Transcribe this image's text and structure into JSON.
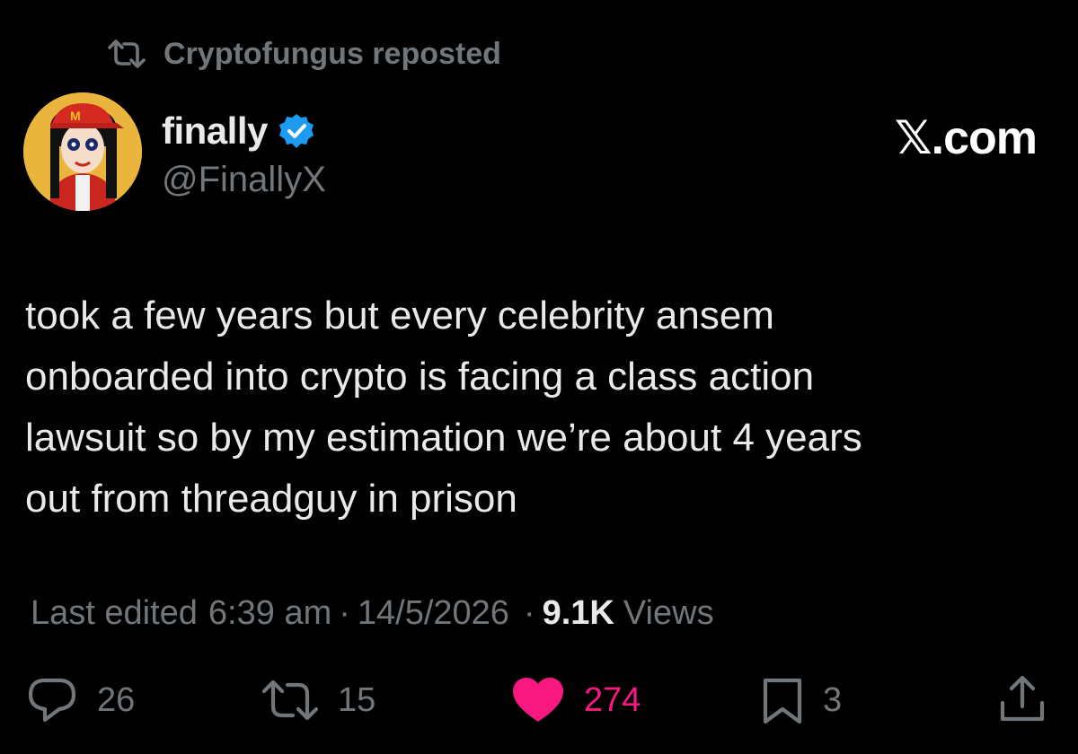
{
  "repost_banner": {
    "text": "Cryptofungus reposted",
    "icon": "repost-icon"
  },
  "author": {
    "display_name": "finally",
    "handle": "@FinallyX",
    "verified": true,
    "verified_color": "#1d9bf0"
  },
  "brand": "𝕏.com",
  "tweet": {
    "lines": [
      "took a few years but every celebrity ansem",
      "onboarded into crypto is facing a class action",
      "lawsuit so by my estimation we’re about 4 years",
      "out from threadguy in prison"
    ]
  },
  "meta": {
    "edited_label": "Last edited",
    "time": "6:39 am",
    "date": "14/5/2026",
    "views_count": "9.1K",
    "views_label": "Views",
    "separator": "·"
  },
  "actions": {
    "reply": {
      "icon": "reply-icon",
      "count": "26"
    },
    "repost": {
      "icon": "repost-icon",
      "count": "15"
    },
    "like": {
      "icon": "heart-icon",
      "count": "274",
      "liked": true,
      "color": "#f91880"
    },
    "bookmark": {
      "icon": "bookmark-icon",
      "count": "3"
    },
    "share": {
      "icon": "share-icon"
    }
  },
  "colors": {
    "background": "#000000",
    "text_primary": "#e7e9ea",
    "text_secondary": "#71767b",
    "like_pink": "#f91880"
  }
}
